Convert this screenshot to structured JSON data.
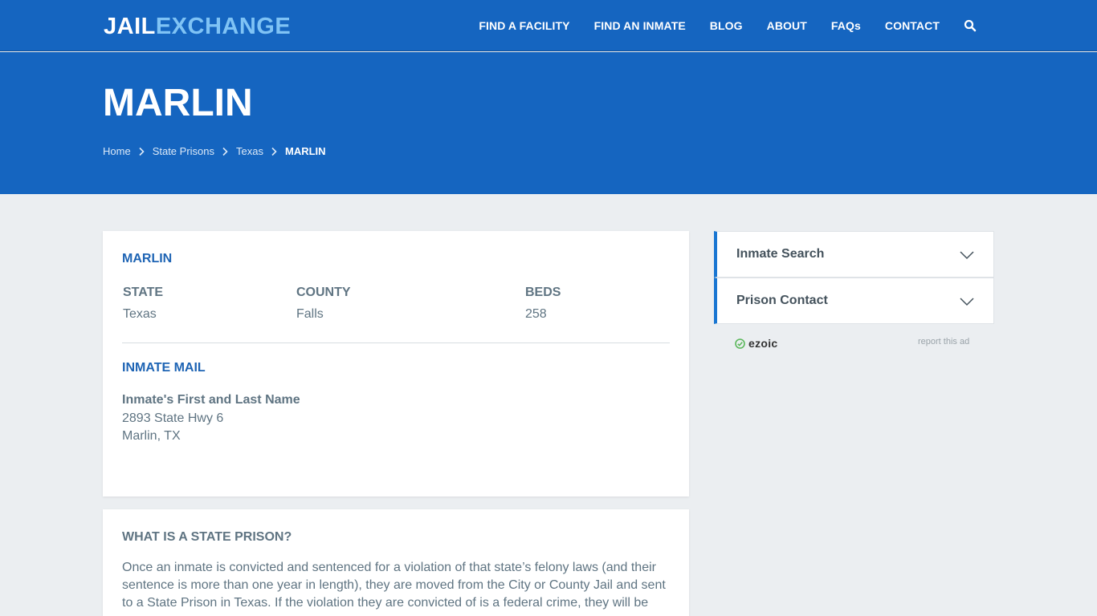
{
  "header": {
    "logo_part1": "JAIL",
    "logo_part2": "EXCHANGE",
    "menu": [
      "FIND A FACILITY",
      "FIND AN INMATE",
      "BLOG",
      "ABOUT",
      "FAQs",
      "CONTACT"
    ]
  },
  "hero": {
    "title": "MARLIN",
    "breadcrumbs": [
      "Home",
      "State Prisons",
      "Texas"
    ],
    "breadcrumb_current": "MARLIN"
  },
  "facility": {
    "name": "MARLIN",
    "state_label": "STATE",
    "state_value": "Texas",
    "county_label": "COUNTY",
    "county_value": "Falls",
    "beds_label": "BEDS",
    "beds_value": "258",
    "mail_heading": "INMATE MAIL",
    "mail_name": "Inmate's First and Last Name",
    "mail_street": "2893 State Hwy 6",
    "mail_city": "Marlin, TX"
  },
  "info": {
    "heading": "WHAT IS A STATE PRISON?",
    "body": "Once an inmate is convicted and sentenced for a violation of that state’s felony laws (and their sentence is more than one year in length), they are moved from the City or County Jail and sent to a State Prison in Texas. If the violation they are convicted of is a federal crime, they will be"
  },
  "sidebar": {
    "items": [
      "Inmate Search",
      "Prison Contact"
    ]
  },
  "ad": {
    "brand": "ezoic",
    "report": "report this ad"
  },
  "colors": {
    "brand_blue": "#1565c0",
    "logo_accent": "#7fc3f5",
    "heading_blue": "#1e64b4"
  }
}
